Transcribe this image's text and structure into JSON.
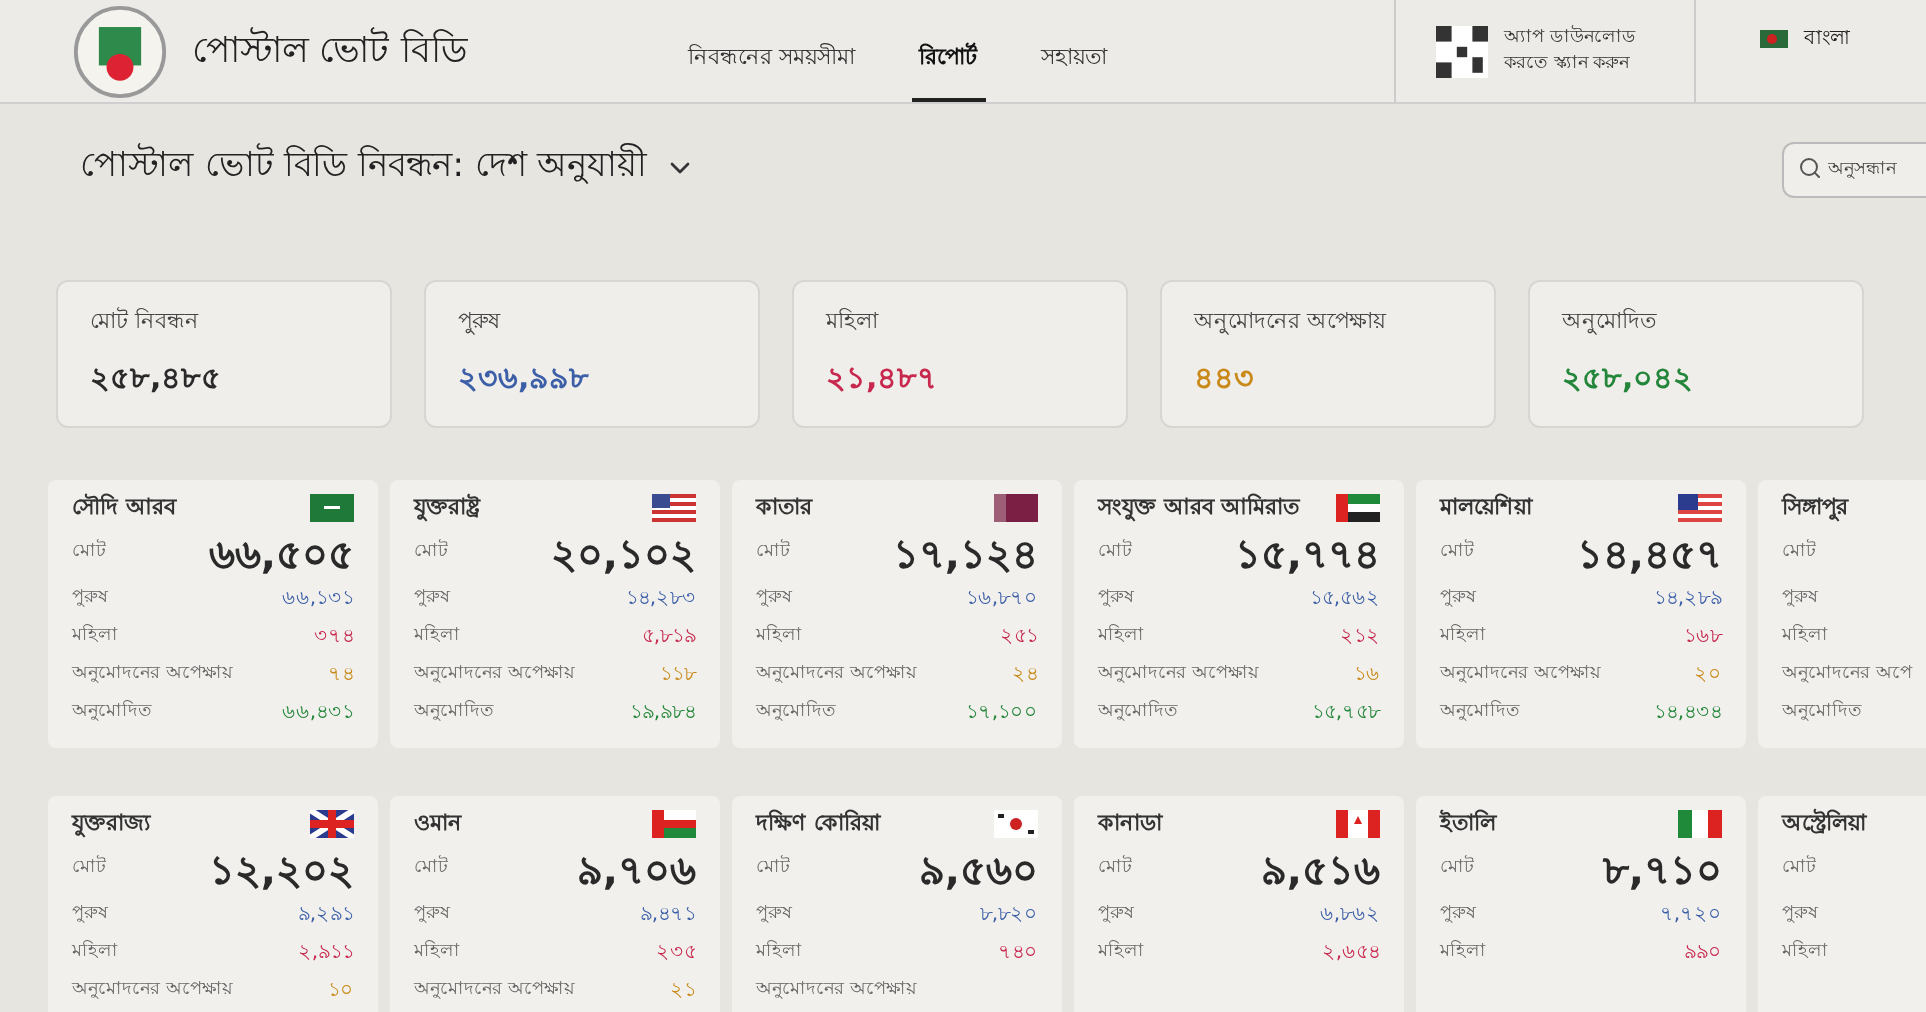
{
  "header": {
    "brand": "পোস্টাল ভোট বিডি",
    "nav": [
      {
        "label": "নিবন্ধনের সময়সীমা",
        "selected": false
      },
      {
        "label": "রিপোর্ট",
        "selected": true
      },
      {
        "label": "সহায়তা",
        "selected": false
      }
    ],
    "app_note": "অ্যাপ ডাউনলোড করতে স্ক্যান করুন",
    "language": "বাংলা"
  },
  "title": "পোস্টাল ভোট বিডি নিবন্ধন: দেশ অনুযায়ী",
  "search": {
    "placeholder": "অনুসন্ধান"
  },
  "summary": [
    {
      "label": "মোট নিবন্ধন",
      "value": "২৫৮,৪৮৫",
      "kind": "total"
    },
    {
      "label": "পুরুষ",
      "value": "২৩৬,৯৯৮",
      "kind": "male"
    },
    {
      "label": "মহিলা",
      "value": "২১,৪৮৭",
      "kind": "female"
    },
    {
      "label": "অনুমোদনের অপেক্ষায়",
      "value": "৪৪৩",
      "kind": "pending"
    },
    {
      "label": "অনুমোদিত",
      "value": "২৫৮,০৪২",
      "kind": "approved"
    }
  ],
  "countries": [
    {
      "name": "সৌদি আরব",
      "kind": "sa",
      "rows": [
        {
          "kind": "total",
          "label": "মোট",
          "value": "৬৬,৫০৫"
        },
        {
          "kind": "male",
          "label": "পুরুষ",
          "value": "৬৬,১৩১"
        },
        {
          "kind": "female",
          "label": "মহিলা",
          "value": "৩৭৪"
        },
        {
          "kind": "pending",
          "label": "অনুমোদনের অপেক্ষায়",
          "value": "৭৪"
        },
        {
          "kind": "approved",
          "label": "অনুমোদিত",
          "value": "৬৬,৪৩১"
        }
      ]
    },
    {
      "name": "যুক্তরাষ্ট্র",
      "kind": "us",
      "rows": [
        {
          "kind": "total",
          "label": "মোট",
          "value": "২০,১০২"
        },
        {
          "kind": "male",
          "label": "পুরুষ",
          "value": "১৪,২৮৩"
        },
        {
          "kind": "female",
          "label": "মহিলা",
          "value": "৫,৮১৯"
        },
        {
          "kind": "pending",
          "label": "অনুমোদনের অপেক্ষায়",
          "value": "১১৮"
        },
        {
          "kind": "approved",
          "label": "অনুমোদিত",
          "value": "১৯,৯৮৪"
        }
      ]
    },
    {
      "name": "কাতার",
      "kind": "qa",
      "rows": [
        {
          "kind": "total",
          "label": "মোট",
          "value": "১৭,১২৪"
        },
        {
          "kind": "male",
          "label": "পুরুষ",
          "value": "১৬,৮৭০"
        },
        {
          "kind": "female",
          "label": "মহিলা",
          "value": "২৫১"
        },
        {
          "kind": "pending",
          "label": "অনুমোদনের অপেক্ষায়",
          "value": "২৪"
        },
        {
          "kind": "approved",
          "label": "অনুমোদিত",
          "value": "১৭,১০০"
        }
      ]
    },
    {
      "name": "সংযুক্ত আরব আমিরাত",
      "kind": "ae",
      "rows": [
        {
          "kind": "total",
          "label": "মোট",
          "value": "১৫,৭৭৪"
        },
        {
          "kind": "male",
          "label": "পুরুষ",
          "value": "১৫,৫৬২"
        },
        {
          "kind": "female",
          "label": "মহিলা",
          "value": "২১২"
        },
        {
          "kind": "pending",
          "label": "অনুমোদনের অপেক্ষায়",
          "value": "১৬"
        },
        {
          "kind": "approved",
          "label": "অনুমোদিত",
          "value": "১৫,৭৫৮"
        }
      ]
    },
    {
      "name": "মালয়েশিয়া",
      "kind": "my",
      "rows": [
        {
          "kind": "total",
          "label": "মোট",
          "value": "১৪,৪৫৭"
        },
        {
          "kind": "male",
          "label": "পুরুষ",
          "value": "১৪,২৮৯"
        },
        {
          "kind": "female",
          "label": "মহিলা",
          "value": "১৬৮"
        },
        {
          "kind": "pending",
          "label": "অনুমোদনের অপেক্ষায়",
          "value": "২০"
        },
        {
          "kind": "approved",
          "label": "অনুমোদিত",
          "value": "১৪,৪৩৪"
        }
      ]
    },
    {
      "name": "সিঙ্গাপুর",
      "rows": [
        {
          "kind": "total",
          "label": "মোট"
        },
        {
          "kind": "male",
          "label": "পুরুষ"
        },
        {
          "kind": "female",
          "label": "মহিলা"
        },
        {
          "kind": "pending",
          "label": "অনুমোদনের অপে"
        },
        {
          "kind": "approved",
          "label": "অনুমোদিত"
        }
      ]
    },
    {
      "name": "যুক্তরাজ্য",
      "kind": "gb",
      "rows": [
        {
          "kind": "total",
          "label": "মোট",
          "value": "১২,২০২"
        },
        {
          "kind": "male",
          "label": "পুরুষ",
          "value": "৯,২৯১"
        },
        {
          "kind": "female",
          "label": "মহিলা",
          "value": "২,৯১১"
        },
        {
          "kind": "pending",
          "label": "অনুমোদনের অপেক্ষায়",
          "value": "১০"
        }
      ]
    },
    {
      "name": "ওমান",
      "kind": "om",
      "rows": [
        {
          "kind": "total",
          "label": "মোট",
          "value": "৯,৭০৬"
        },
        {
          "kind": "male",
          "label": "পুরুষ",
          "value": "৯,৪৭১"
        },
        {
          "kind": "female",
          "label": "মহিলা",
          "value": "২৩৫"
        },
        {
          "kind": "pending",
          "label": "অনুমোদনের অপেক্ষায়",
          "value": "২১"
        }
      ]
    },
    {
      "name": "দক্ষিণ কোরিয়া",
      "kind": "kr",
      "rows": [
        {
          "kind": "total",
          "label": "মোট",
          "value": "৯,৫৬০"
        },
        {
          "kind": "male",
          "label": "পুরুষ",
          "value": "৮,৮২০"
        },
        {
          "kind": "female",
          "label": "মহিলা",
          "value": "৭৪০"
        },
        {
          "kind": "pending",
          "label": "অনুমোদনের অপেক্ষায়"
        }
      ]
    },
    {
      "name": "কানাডা",
      "kind": "ca",
      "rows": [
        {
          "kind": "total",
          "label": "মোট",
          "value": "৯,৫১৬"
        },
        {
          "kind": "male",
          "label": "পুরুষ",
          "value": "৬,৮৬২"
        },
        {
          "kind": "female",
          "label": "মহিলা",
          "value": "২,৬৫৪"
        }
      ]
    },
    {
      "name": "ইতালি",
      "kind": "it",
      "rows": [
        {
          "kind": "total",
          "label": "মোট",
          "value": "৮,৭১০"
        },
        {
          "kind": "male",
          "label": "পুরুষ",
          "value": "৭,৭২০"
        },
        {
          "kind": "female",
          "label": "মহিলা",
          "value": "৯৯০"
        }
      ]
    },
    {
      "name": "অস্ট্রেলিয়া",
      "rows": [
        {
          "kind": "total",
          "label": "মোট"
        },
        {
          "kind": "male",
          "label": "পুরুষ"
        },
        {
          "kind": "female",
          "label": "মহিলা"
        }
      ]
    }
  ]
}
